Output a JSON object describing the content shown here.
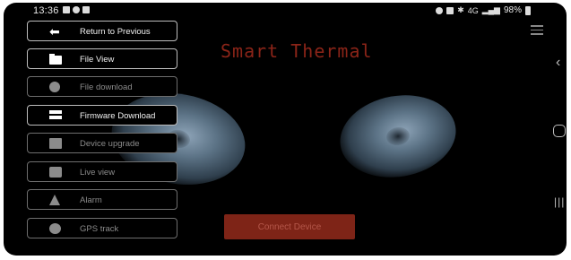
{
  "status_bar": {
    "time": "13:36",
    "signal_text": "4G",
    "battery": "98%"
  },
  "app": {
    "title": "Smart Thermal",
    "connect_label": "Connect Device",
    "accent_color": "#8a2418"
  },
  "menu": {
    "items": [
      {
        "label": "Return to Previous",
        "icon": "back-arrow-icon",
        "enabled": true
      },
      {
        "label": "File View",
        "icon": "folder-icon",
        "enabled": true
      },
      {
        "label": "File download",
        "icon": "download-icon",
        "enabled": false
      },
      {
        "label": "Firmware Download",
        "icon": "firmware-icon",
        "enabled": true
      },
      {
        "label": "Device upgrade",
        "icon": "device-upgrade-icon",
        "enabled": false
      },
      {
        "label": "Live view",
        "icon": "camera-icon",
        "enabled": false
      },
      {
        "label": "Alarm",
        "icon": "bell-icon",
        "enabled": false
      },
      {
        "label": "GPS track",
        "icon": "gps-icon",
        "enabled": false
      }
    ]
  },
  "nav": {
    "back": "back-icon",
    "home": "home-icon",
    "recents": "recents-icon"
  }
}
